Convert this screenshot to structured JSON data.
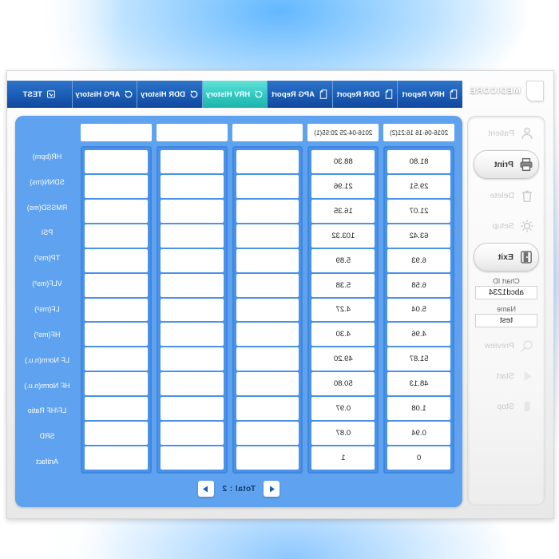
{
  "app": {
    "brand": "MEDICORE",
    "logo_icon": "shield-logo-icon"
  },
  "tabs": [
    {
      "label": "HRV Report",
      "icon": "report-page-icon",
      "active": false
    },
    {
      "label": "DDR Report",
      "icon": "report-page-icon",
      "active": false
    },
    {
      "label": "APG Report",
      "icon": "report-page-icon",
      "active": false
    },
    {
      "label": "HRV History",
      "icon": "history-arrow-icon",
      "active": true
    },
    {
      "label": "DDR History",
      "icon": "history-arrow-icon",
      "active": false
    },
    {
      "label": "APG History",
      "icon": "history-arrow-icon",
      "active": false
    },
    {
      "label": "TEST",
      "icon": "test-screen-icon",
      "active": false
    }
  ],
  "sidebar": {
    "buttons": [
      {
        "label": "Patient",
        "icon": "person-icon",
        "state": "disabled"
      },
      {
        "label": "Print",
        "icon": "printer-icon",
        "state": "enabled"
      },
      {
        "label": "Delete",
        "icon": "trash-icon",
        "state": "disabled"
      },
      {
        "label": "Setup",
        "icon": "gear-icon",
        "state": "disabled"
      },
      {
        "label": "Exit",
        "icon": "exit-door-icon",
        "state": "enabled"
      }
    ],
    "fields": [
      {
        "caption": "Chart ID",
        "value": "abcd1234"
      },
      {
        "caption": "Name",
        "value": "test"
      }
    ],
    "buttons_bottom": [
      {
        "label": "Preview",
        "icon": "magnifier-icon",
        "state": "disabled"
      },
      {
        "label": "Start",
        "icon": "play-left-icon",
        "state": "disabled"
      },
      {
        "label": "Stop",
        "icon": "stop-square-icon",
        "state": "disabled"
      }
    ]
  },
  "table": {
    "row_labels": [
      "HR(bpm)",
      "SDNN(ms)",
      "RMSSD(ms)",
      "PSI",
      "TP(ms²)",
      "VLF(ms²)",
      "LF(ms²)",
      "HF(ms²)",
      "LF Norm(n.u.)",
      "HF Norm(n.u.)",
      "LF/HF Ratio",
      "SRD",
      "Artifact"
    ],
    "columns": [
      {
        "header": "2016-06-16 16:21(2)",
        "empty": false,
        "values": [
          "81.80",
          "29.51",
          "21.07",
          "63.42",
          "6.93",
          "6.58",
          "5.04",
          "4.96",
          "51.87",
          "48.13",
          "1.08",
          "0.94",
          "0"
        ]
      },
      {
        "header": "2016-04-25 20:55(1)",
        "empty": false,
        "values": [
          "88.30",
          "21.96",
          "16.35",
          "103.32",
          "5.89",
          "5.38",
          "4.27",
          "4.30",
          "49.20",
          "50.80",
          "0.97",
          "0.87",
          "1"
        ]
      },
      {
        "header": "",
        "empty": true,
        "values": [
          "",
          "",
          "",
          "",
          "",
          "",
          "",
          "",
          "",
          "",
          "",
          "",
          ""
        ]
      },
      {
        "header": "",
        "empty": true,
        "values": [
          "",
          "",
          "",
          "",
          "",
          "",
          "",
          "",
          "",
          "",
          "",
          "",
          ""
        ]
      },
      {
        "header": "",
        "empty": true,
        "values": [
          "",
          "",
          "",
          "",
          "",
          "",
          "",
          "",
          "",
          "",
          "",
          "",
          ""
        ]
      }
    ]
  },
  "pager": {
    "total_label": "Total : 2",
    "prev_icon": "triangle-left-icon",
    "next_icon": "triangle-right-icon"
  },
  "colors": {
    "panel_blue": "#5fa2ef",
    "tab_blue": "#1b5fb8",
    "tab_active_teal": "#2ec9c0",
    "grid_border": "#3f87df"
  }
}
